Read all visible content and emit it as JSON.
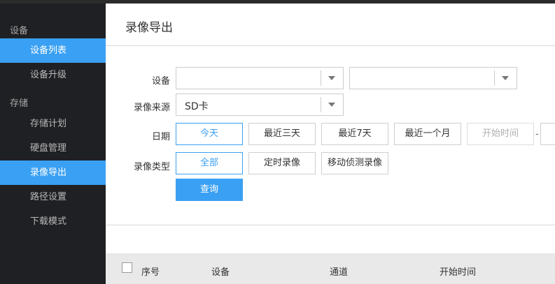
{
  "sidebar": {
    "group_device": "设备",
    "item_device_list": "设备列表",
    "item_device_upgrade": "设备升级",
    "group_storage": "存储",
    "item_storage_plan": "存储计划",
    "item_disk_mgmt": "硬盘管理",
    "item_record_export": "录像导出",
    "item_path_settings": "路径设置",
    "item_download_mode": "下载模式"
  },
  "main": {
    "title": "录像导出",
    "form": {
      "device_label": "设备",
      "device_value_1": "",
      "device_value_2": "",
      "source_label": "录像来源",
      "source_value": "SD卡",
      "date_label": "日期",
      "date_buttons": [
        "今天",
        "最近三天",
        "最近7天",
        "最近一个月"
      ],
      "start_time_placeholder": "开始时间",
      "range_dash": "-",
      "type_label": "录像类型",
      "type_buttons": [
        "全部",
        "定时录像",
        "移动侦测录像"
      ],
      "query_button": "查询"
    },
    "table": {
      "columns": [
        "序号",
        "设备",
        "通道",
        "开始时间"
      ]
    }
  },
  "colors": {
    "accent": "#3aa0f3",
    "sidebar_bg": "#1f2023"
  }
}
